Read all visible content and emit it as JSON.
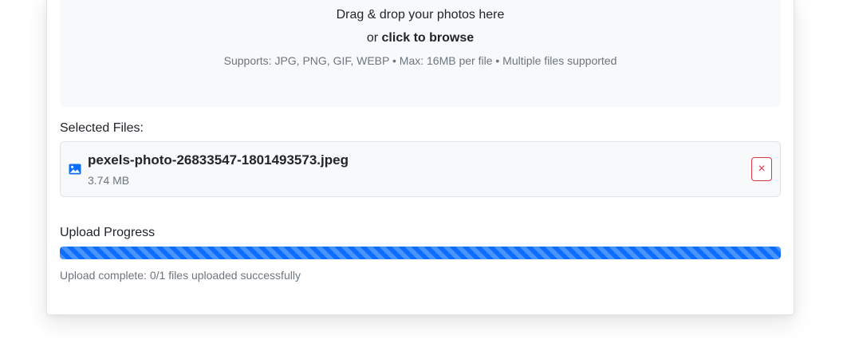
{
  "dropzone": {
    "title": "Drag & drop your photos here",
    "sub_prefix": "or ",
    "sub_action": "click to browse",
    "hint": "Supports: JPG, PNG, GIF, WEBP • Max: 16MB per file • Multiple files supported"
  },
  "selected": {
    "label": "Selected Files:",
    "files": [
      {
        "icon": "image-icon",
        "name": "pexels-photo-26833547-1801493573.jpeg",
        "size": "3.74 MB",
        "remove_label": "×"
      }
    ]
  },
  "progress": {
    "label": "Upload Progress",
    "percent": 100,
    "status": "Upload complete: 0/1 files uploaded successfully"
  },
  "colors": {
    "primary": "#0d6efd",
    "danger": "#dc3545",
    "muted": "#6c757d"
  }
}
